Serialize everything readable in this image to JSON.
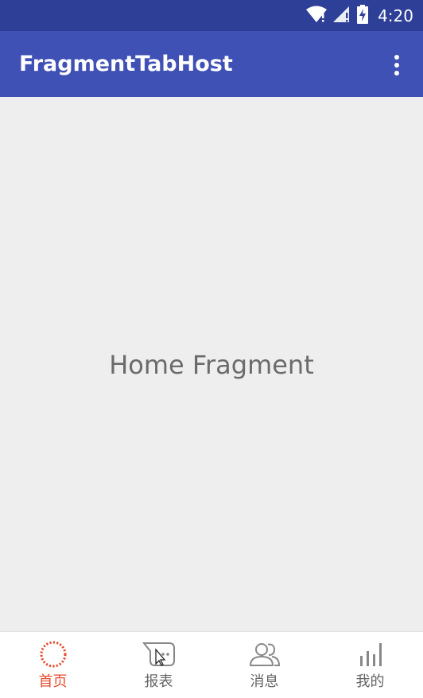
{
  "status_bar": {
    "time": "4:20",
    "icons": [
      "wifi-icon",
      "signal-icon",
      "battery-charging-icon"
    ]
  },
  "app_bar": {
    "title": "FragmentTabHost",
    "overflow_icon": "more-vert-icon"
  },
  "content": {
    "text": "Home Fragment"
  },
  "tabs": [
    {
      "label": "首页",
      "icon": "home-circle-icon",
      "active": true
    },
    {
      "label": "报表",
      "icon": "report-icon",
      "active": false
    },
    {
      "label": "消息",
      "icon": "people-icon",
      "active": false
    },
    {
      "label": "我的",
      "icon": "bar-chart-icon",
      "active": false
    }
  ],
  "colors": {
    "status_bar": "#2d3f97",
    "app_bar": "#3f51b5",
    "active_tab": "#e64a2e",
    "inactive_tab": "#666666",
    "background": "#eeeeee"
  }
}
